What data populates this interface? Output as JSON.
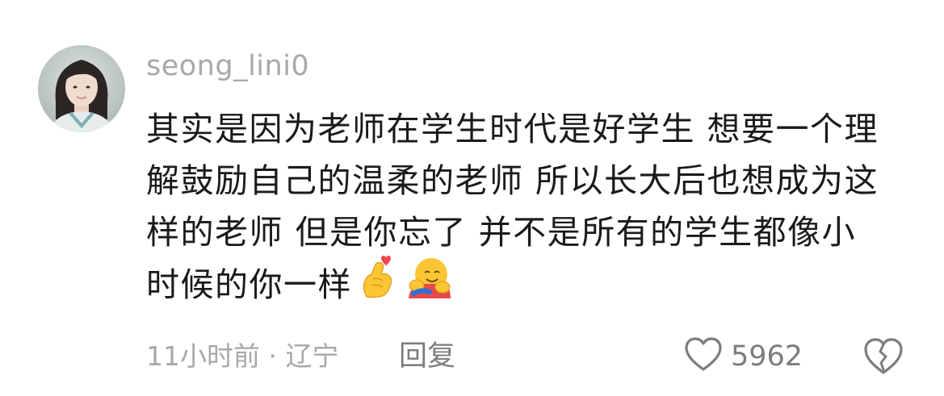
{
  "comment": {
    "username": "seong_lini0",
    "text_lines": [
      "其实是因为老师在学生时代是好学生 想要一个理",
      "解鼓励自己的温柔的老师 所以长大后也想成为这",
      "样的老师 但是你忘了 并不是所有的学生都像小",
      "时候的你一样"
    ],
    "emojis": [
      "finger-heart-emoji",
      "hugging-face-emoji"
    ],
    "time_location": "11小时前 · 辽宁",
    "reply_label": "回复",
    "like_count": "5962"
  },
  "colors": {
    "text_primary": "#1a1a1a",
    "text_secondary": "#a8a8a8",
    "action_gray": "#7c7c7c",
    "background": "#ffffff"
  }
}
